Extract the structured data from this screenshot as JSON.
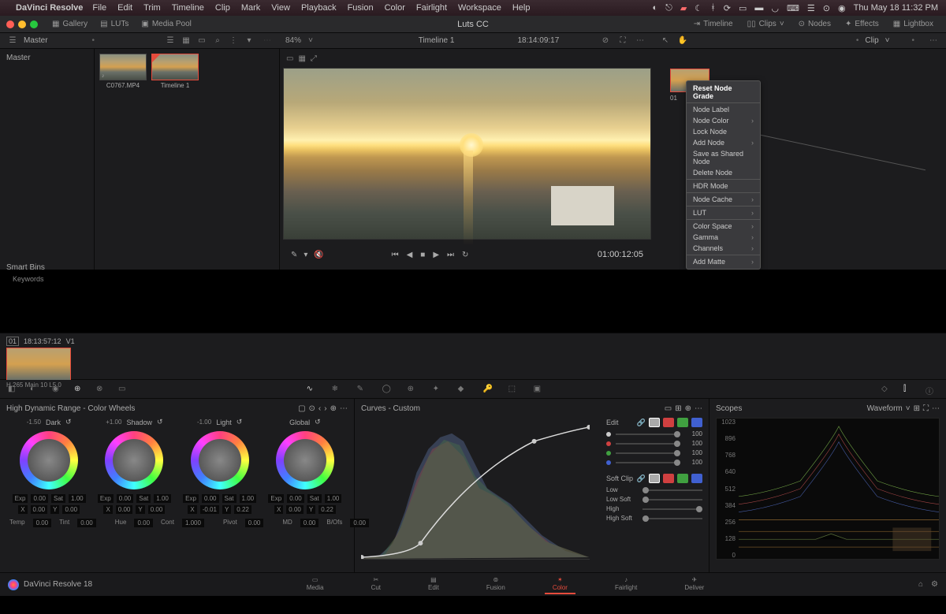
{
  "menubar": {
    "app": "DaVinci Resolve",
    "items": [
      "File",
      "Edit",
      "Trim",
      "Timeline",
      "Clip",
      "Mark",
      "View",
      "Playback",
      "Fusion",
      "Color",
      "Fairlight",
      "Workspace",
      "Help"
    ],
    "datetime": "Thu May 18  11:32 PM"
  },
  "toolbar": {
    "gallery": "Gallery",
    "luts": "LUTs",
    "mediapool": "Media Pool",
    "title": "Luts CC",
    "timeline": "Timeline",
    "clips": "Clips",
    "nodes": "Nodes",
    "effects": "Effects",
    "lightbox": "Lightbox"
  },
  "subbar": {
    "master": "Master",
    "zoom": "84%",
    "timeline_name": "Timeline 1",
    "record_tc": "18:14:09:17",
    "clip_label": "Clip"
  },
  "browser": {
    "clip1": "C0767.MP4",
    "clip2": "Timeline 1"
  },
  "viewer": {
    "tc": "01:00:12:05"
  },
  "context_menu": {
    "reset": "Reset Node Grade",
    "label": "Node Label",
    "color": "Node Color",
    "lock": "Lock Node",
    "add": "Add Node",
    "shared": "Save as Shared Node",
    "delete": "Delete Node",
    "hdr": "HDR Mode",
    "cache": "Node Cache",
    "lut": "LUT",
    "colorspace": "Color Space",
    "gamma": "Gamma",
    "channels": "Channels",
    "matte": "Add Matte"
  },
  "node": {
    "num": "01"
  },
  "smartbins": {
    "title": "Smart Bins",
    "keywords": "Keywords"
  },
  "clipstrip": {
    "num": "01",
    "tc": "18:13:57:12",
    "track": "V1",
    "codec": "H.265 Main 10 L5.0"
  },
  "wheels": {
    "title": "High Dynamic Range - Color Wheels",
    "names": [
      "Dark",
      "Shadow",
      "Light",
      "Global"
    ],
    "vals": [
      "-1.50",
      "+1.00",
      "-1.00",
      ""
    ],
    "exp": "Exp",
    "sat": "Sat",
    "exp_val": "0.00",
    "sat_val": "1.00",
    "x": "X",
    "y": "Y",
    "x_val": "0.00",
    "y_val": "0.00",
    "wheel3_y": "0.22",
    "wheel4_y": "0.22",
    "temp": "Temp",
    "temp_val": "0.00",
    "tint": "Tint",
    "tint_val": "0.00",
    "hue": "Hue",
    "hue_val": "0.00",
    "cont": "Cont",
    "cont_val": "1.000",
    "pivot": "Pivot",
    "pivot_val": "0.00",
    "md": "MD",
    "md_val": "0.00",
    "bofs": "B/Ofs",
    "bofs_val": "0.00"
  },
  "curves": {
    "title": "Curves - Custom",
    "edit": "Edit",
    "softclip": "Soft Clip",
    "slider_val": "100",
    "low": "Low",
    "lowsoft": "Low Soft",
    "high": "High",
    "highsoft": "High Soft"
  },
  "scopes": {
    "title": "Scopes",
    "mode": "Waveform",
    "yaxis": [
      "1023",
      "896",
      "768",
      "640",
      "512",
      "384",
      "256",
      "128",
      "0"
    ]
  },
  "pagenav": {
    "brand": "DaVinci Resolve 18",
    "tabs": [
      "Media",
      "Cut",
      "Edit",
      "Fusion",
      "Color",
      "Fairlight",
      "Deliver"
    ]
  }
}
